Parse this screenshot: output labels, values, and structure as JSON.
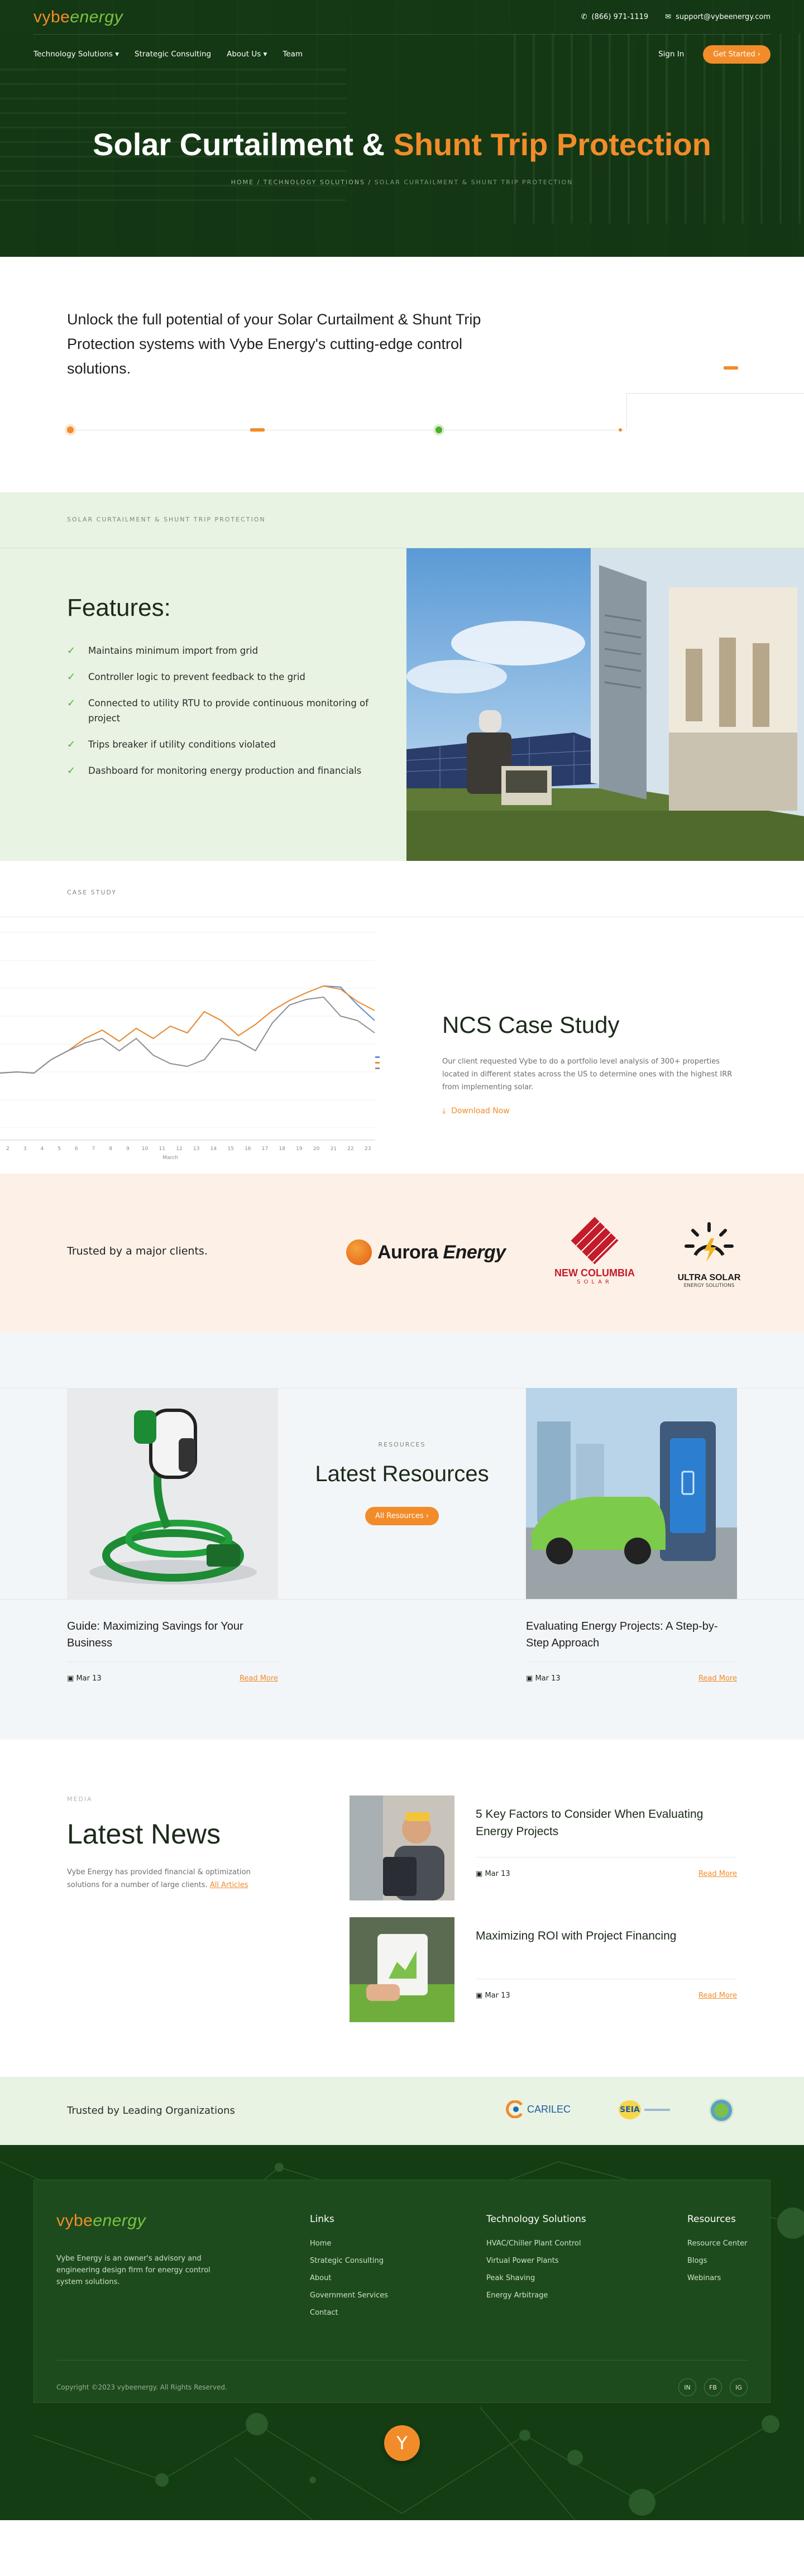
{
  "brand": {
    "logo_prefix": "v",
    "logo_y": "y",
    "logo_be": "be",
    "logo_energy": "energy",
    "accent": "#f28c2a",
    "green": "#4caf2e",
    "dark_green": "#143d14"
  },
  "topbar": {
    "phone": "(866) 971-1119",
    "email": "support@vybeenergy.com",
    "phone_icon": "phone-icon",
    "email_icon": "mail-icon"
  },
  "nav": {
    "items": [
      "Technology Solutions",
      "Strategic Consulting",
      "About Us",
      "Team"
    ],
    "signin": "Sign In",
    "cta": "Get Started"
  },
  "hero": {
    "title_a": "Solar Curtailment &",
    "title_b": "Shunt Trip Protection",
    "crumbs": [
      "HOME",
      "TECHNOLOGY SOLUTIONS",
      "SOLAR CURTAILMENT & SHUNT TRIP PROTECTION"
    ]
  },
  "intro": {
    "text": "Unlock the full potential of your Solar Curtailment & Shunt Trip Protection systems with Vybe Energy's cutting-edge control solutions."
  },
  "features": {
    "section_label": "SOLAR CURTAILMENT & SHUNT TRIP PROTECTION",
    "title": "Features:",
    "items": [
      "Maintains minimum import from grid",
      "Controller logic to prevent feedback to the grid",
      "Connected to utility RTU to provide continuous monitoring of project",
      "Trips breaker if utility conditions violated",
      "Dashboard for monitoring energy production and financials"
    ]
  },
  "case_study": {
    "section_label": "CASE STUDY",
    "title": "NCS Case Study",
    "text": "Our client requested Vybe to do a portfolio level analysis of 300+ properties located in different states across the US to determine ones with the highest IRR from implementing solar.",
    "download": "Download Now",
    "chart_axis_label": "March",
    "chart_x": [
      "2",
      "3",
      "4",
      "5",
      "6",
      "7",
      "8",
      "9",
      "10",
      "11",
      "12",
      "13",
      "14",
      "15",
      "16",
      "17",
      "18",
      "19",
      "20",
      "21",
      "22",
      "23"
    ]
  },
  "clients": {
    "label": "Trusted by a major clients.",
    "logo1": "Aurora",
    "logo1b": "Energy",
    "logo2a": "NEW COLUMBIA",
    "logo2b": "SOLAR",
    "logo3a": "ULTRA SOLAR",
    "logo3b": "ENERGY SOLUTIONS"
  },
  "resources": {
    "section_label": "RESOURCES",
    "title": "Latest Resources",
    "button": "All Resources",
    "cards": [
      {
        "title": "Guide: Maximizing Savings for Your Business",
        "date": "Mar 13",
        "link": "Read More"
      },
      {
        "title": "Evaluating Energy Projects: A Step-by-Step Approach",
        "date": "Mar 13",
        "link": "Read More"
      }
    ]
  },
  "news": {
    "section_label": "MEDIA",
    "title": "Latest News",
    "text": "Vybe Energy has provided financial & optimization solutions for a number of large clients.",
    "link": "All Articles",
    "items": [
      {
        "title": "5 Key Factors to Consider When Evaluating Energy Projects",
        "date": "Mar 13",
        "link": "Read More"
      },
      {
        "title": "Maximizing ROI with Project Financing",
        "date": "Mar 13",
        "link": "Read More"
      }
    ]
  },
  "trusted": {
    "label": "Trusted by Leading Organizations",
    "logo1": "CARILEC",
    "logo2": "SEIA"
  },
  "footer": {
    "description": "Vybe Energy is an owner's advisory and engineering design firm for energy control system solutions.",
    "cols": [
      {
        "title": "Links",
        "items": [
          "Home",
          "Strategic Consulting",
          "About",
          "Government Services",
          "Contact"
        ]
      },
      {
        "title": "Technology Solutions",
        "items": [
          "HVAC/Chiller Plant Control",
          "Virtual Power Plants",
          "Peak Shaving",
          "Energy Arbitrage"
        ]
      },
      {
        "title": "Resources",
        "items": [
          "Resource Center",
          "Blogs",
          "Webinars"
        ]
      }
    ],
    "copyright": "Copyright ©2023 vybeenergy. All Rights Reserved.",
    "social": [
      "IN",
      "FB",
      "IG"
    ]
  }
}
